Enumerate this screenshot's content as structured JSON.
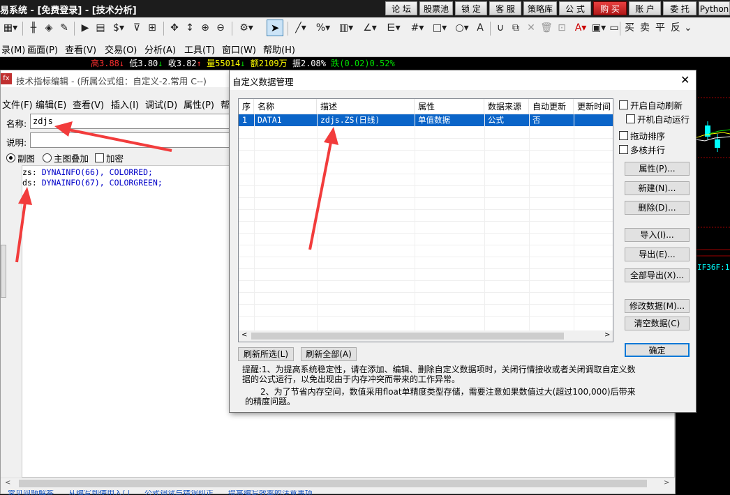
{
  "app": {
    "title": "易系统 - [免费登录] - [技术分析]",
    "top_buttons": [
      "论 坛",
      "股票池",
      "锁 定",
      "客 服",
      "策略库",
      "公 式",
      "购 买",
      "账 户",
      "委 托",
      "Python"
    ]
  },
  "menubar": [
    "录(M)",
    "画面(P)",
    "查看(V)",
    "交易(O)",
    "分析(A)",
    "工具(T)",
    "窗口(W)",
    "帮助(H)"
  ],
  "quote": {
    "high": "高3.88",
    "low": "低3.80",
    "close": "收3.82",
    "volume": "量55014",
    "amount": "额2109万",
    "amplitude": "振2.08%",
    "change": "跌(0.02)0.52%",
    "colors": {
      "red": "#ff3030",
      "green": "#00e000",
      "yellow": "#ffff00",
      "cyan": "#00ffff",
      "white": "#ffffff"
    }
  },
  "chart": {
    "code_label": "IF36F:1"
  },
  "editor": {
    "title": "技术指标编辑 - (所属公式组：自定义-2.常用 C--)",
    "menu": [
      "文件(F)",
      "编辑(E)",
      "查看(V)",
      "插入(I)",
      "调试(D)",
      "属性(P)",
      "帮"
    ],
    "name_label": "名称:",
    "name_value": "zdjs",
    "desc_label": "说明:",
    "radio_sub": "副图",
    "radio_main": "主图叠加",
    "check_encrypt": "加密",
    "code_lines": [
      {
        "var": "zs:",
        "func": "DYNAINFO(66),",
        "color": "COLORRED;"
      },
      {
        "var": "ds:",
        "func": "DYNAINFO(67),",
        "color": "COLORGREEN;"
      }
    ],
    "status_hint": "常见问题解答      从编写到使用入门      公式调试与错误纠正      提高编写效率的注意事项"
  },
  "dialog": {
    "title": "自定义数据管理",
    "columns": [
      "序",
      "名称",
      "描述",
      "属性",
      "数据来源",
      "自动更新",
      "更新时间"
    ],
    "rows": [
      {
        "no": "1",
        "name": "DATA1",
        "desc": "zdjs.ZS(日线)",
        "attr": "单值数据",
        "source": "公式",
        "auto": "否",
        "time": ""
      }
    ],
    "options": {
      "auto_refresh": "开启自动刷新",
      "auto_run": "开机自动运行",
      "drag_sort": "拖动排序",
      "multicore": "多核并行"
    },
    "buttons": {
      "props": "属性(P)...",
      "new": "新建(N)...",
      "delete": "删除(D)...",
      "import": "导入(I)...",
      "export": "导出(E)...",
      "export_all": "全部导出(X)...",
      "modify": "修改数据(M)...",
      "clear": "清空数据(C)",
      "ok": "确定",
      "refresh_sel": "刷新所选(L)",
      "refresh_all": "刷新全部(A)"
    },
    "tip1": "提醒:1、为提高系统稳定性，请在添加、编辑、删除自定义数据项时，关闭行情接收或者关闭调取自定义数据的公式运行，以免出现由于内存冲突而带来的工作异常。",
    "tip2": "2、为了节省内存空间，数值采用float单精度类型存储，需要注意如果数值过大(超过100,000)后带来的精度问题。"
  }
}
